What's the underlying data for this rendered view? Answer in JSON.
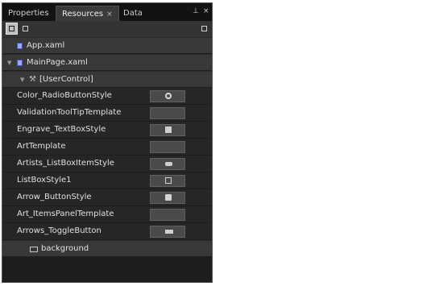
{
  "tabs": [
    {
      "label": "Properties"
    },
    {
      "label": "Resources",
      "close": "×"
    },
    {
      "label": "Data"
    }
  ],
  "header_icons": {
    "pin": "pin-icon",
    "close": "close-icon",
    "pin_glyph": "⊥",
    "close_glyph": "×"
  },
  "toolbar": {
    "left_buttons": [
      "list-view-icon",
      "grid-view-icon"
    ],
    "right_button": "new-resource-icon"
  },
  "tree": {
    "app": "App.xaml",
    "main": "MainPage.xaml",
    "user_control": "[UserControl]",
    "user_control_icon": "⚒",
    "expand_arrow": "▼",
    "resources": [
      {
        "name": "Color_RadioButtonStyle",
        "icon": "radio-icon"
      },
      {
        "name": "ValidationToolTipTemplate",
        "icon": ""
      },
      {
        "name": "Engrave_TextBoxStyle",
        "icon": "textbox-icon"
      },
      {
        "name": "ArtTemplate",
        "icon": ""
      },
      {
        "name": "Artists_ListBoxItemStyle",
        "icon": "listitem-icon"
      },
      {
        "name": "ListBoxStyle1",
        "icon": "listbox-icon"
      },
      {
        "name": "Arrow_ButtonStyle",
        "icon": "button-icon"
      },
      {
        "name": "Art_ItemsPanelTemplate",
        "icon": ""
      },
      {
        "name": "Arrows_ToggleButton",
        "icon": "toggle-icon"
      }
    ],
    "brush": "background"
  }
}
